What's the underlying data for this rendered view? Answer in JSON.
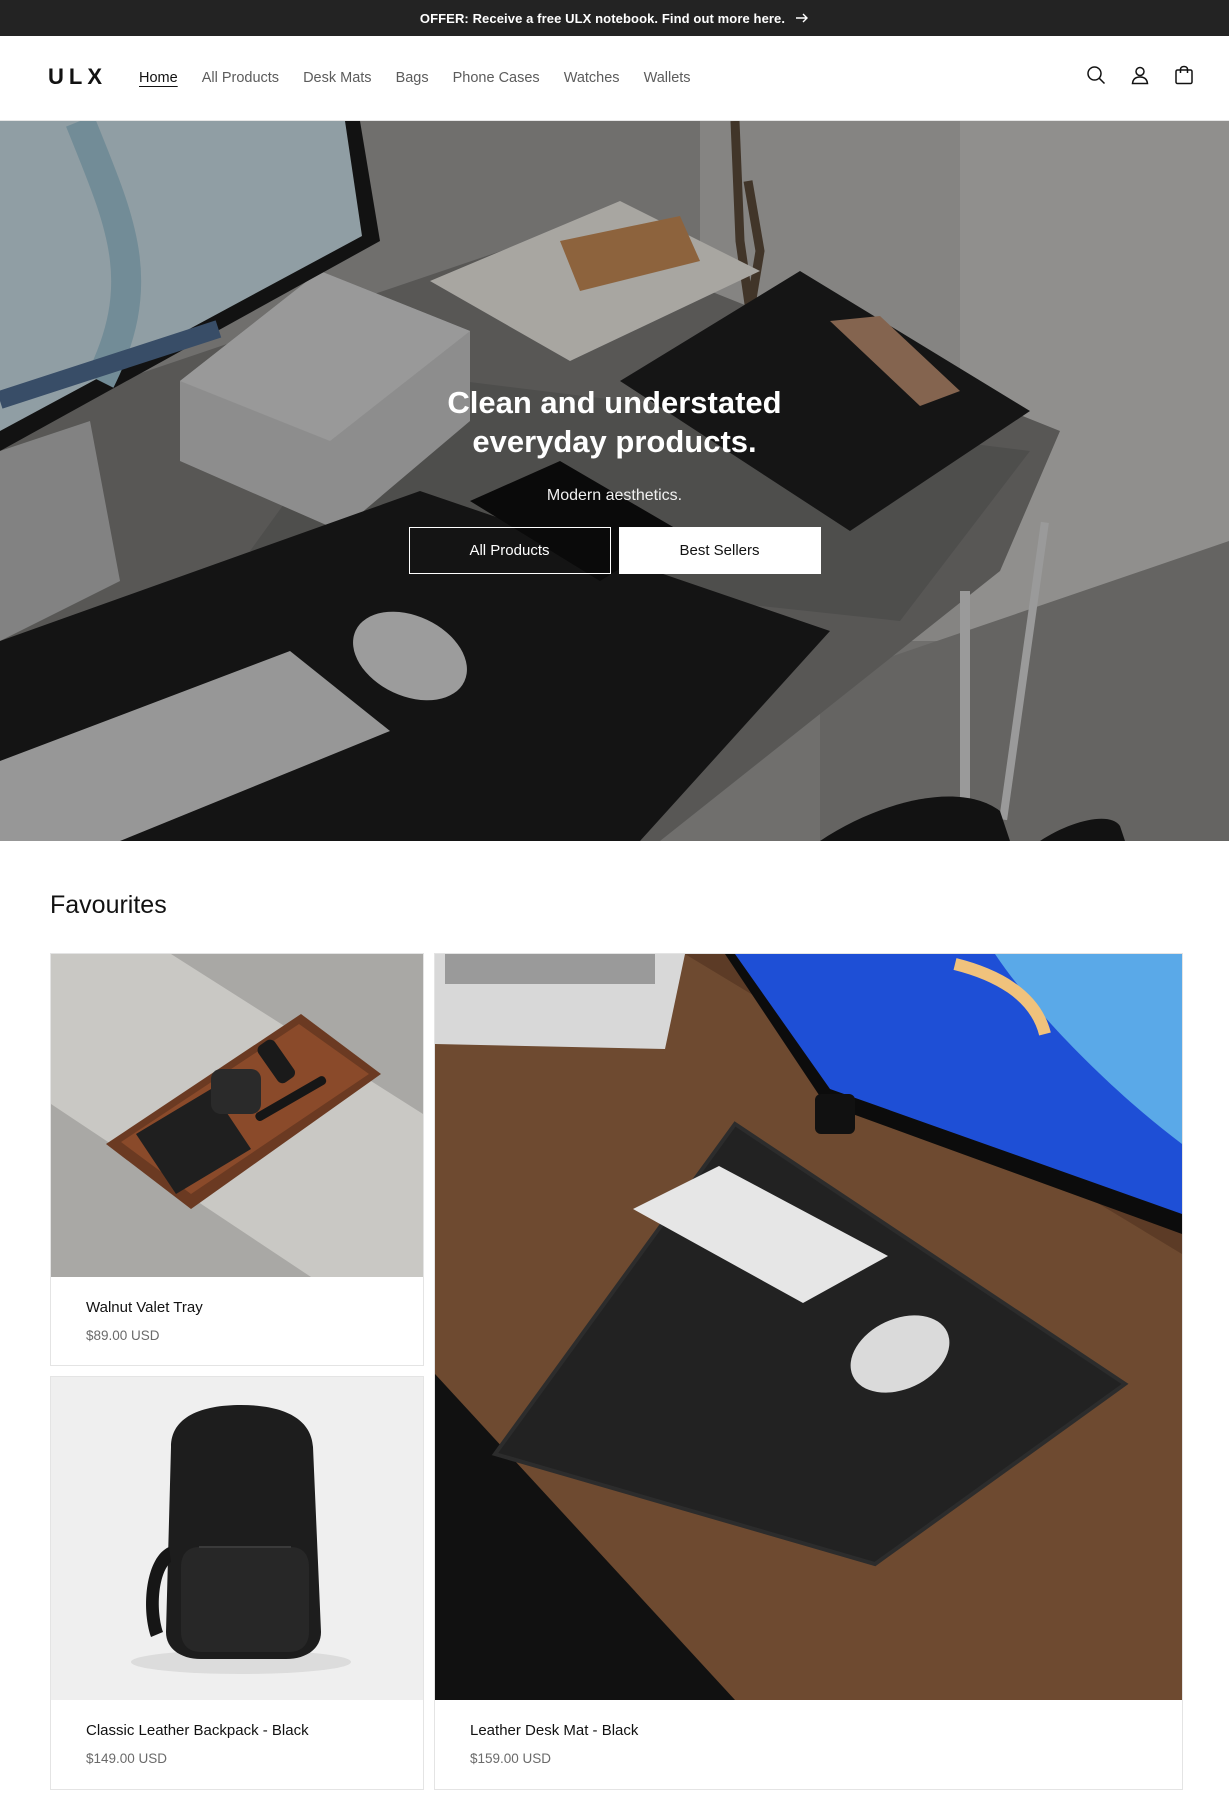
{
  "announcement": {
    "text": "OFFER: Receive a free ULX notebook. Find out more here.",
    "icon": "arrow-right-icon"
  },
  "header": {
    "logo": "ULX",
    "nav": [
      {
        "label": "Home",
        "active": true
      },
      {
        "label": "All Products"
      },
      {
        "label": "Desk Mats"
      },
      {
        "label": "Bags"
      },
      {
        "label": "Phone Cases"
      },
      {
        "label": "Watches"
      },
      {
        "label": "Wallets"
      }
    ],
    "icons": [
      "search-icon",
      "account-icon",
      "cart-icon"
    ]
  },
  "hero": {
    "title": "Clean and understated everyday products.",
    "subtitle": "Modern aesthetics.",
    "primary_button": "All Products",
    "secondary_button": "Best Sellers"
  },
  "favourites": {
    "title": "Favourites",
    "products": [
      {
        "name": "Walnut Valet Tray",
        "price": "$89.00 USD"
      },
      {
        "name": "Classic Leather Backpack - Black",
        "price": "$149.00 USD"
      },
      {
        "name": "Leather Desk Mat - Black",
        "price": "$159.00 USD"
      }
    ]
  },
  "colors": {
    "announcement_bg": "#232323",
    "text": "#121212",
    "muted": "#6a6a6a",
    "border": "#e4e4e4"
  }
}
